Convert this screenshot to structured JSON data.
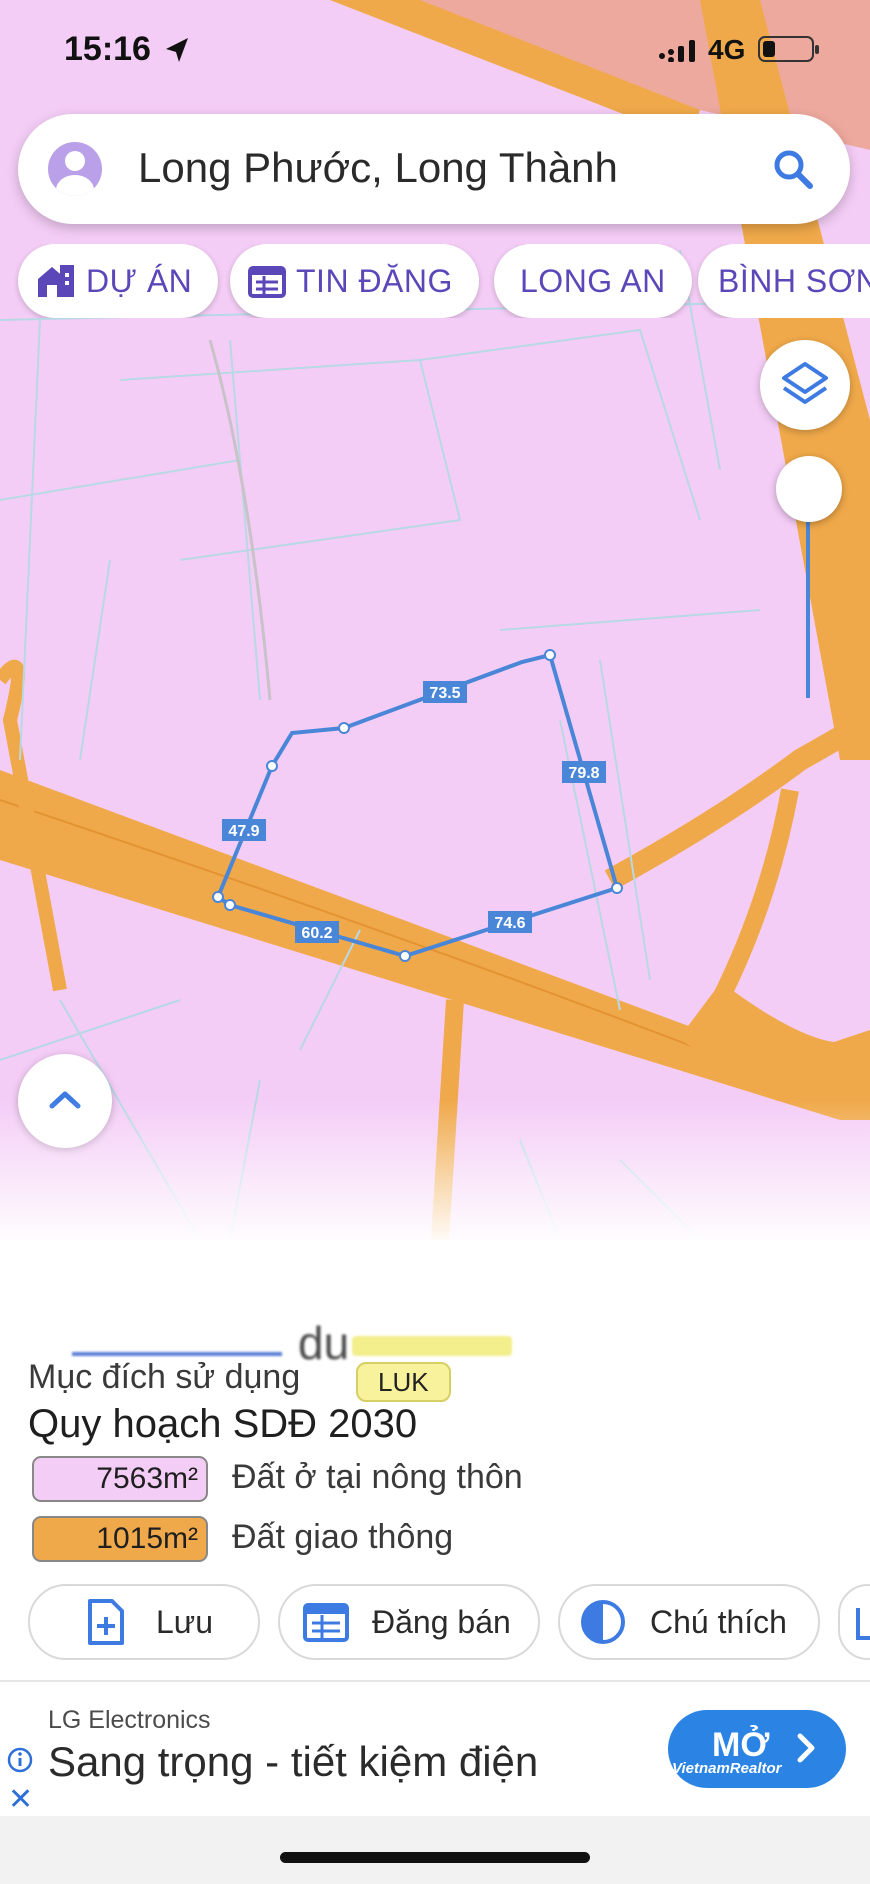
{
  "status_bar": {
    "time": "15:16",
    "network": "4G"
  },
  "search": {
    "query": "Long Phước, Long Thành"
  },
  "chips": [
    {
      "label": "DỰ ÁN",
      "icon": "house-building-icon"
    },
    {
      "label": "TIN ĐĂNG",
      "icon": "calendar-list-icon"
    },
    {
      "label": "LONG AN",
      "icon": ""
    },
    {
      "label": "BÌNH SƠN",
      "icon": ""
    }
  ],
  "map": {
    "edge_labels": [
      "73.5",
      "79.8",
      "74.6",
      "60.2",
      "47.9"
    ],
    "colors": {
      "residential": "#f4cdf6",
      "road": "#f0a94a",
      "parcel_line": "#4a86d8",
      "lot_line": "#b7d8e4"
    }
  },
  "panel": {
    "blurred_text": "du",
    "purpose_label": "Mục đích sử dụng",
    "purpose_code": "LUK",
    "plan_title": "Quy hoạch SDĐ 2030",
    "zones": [
      {
        "area": "7563m²",
        "label": "Đất ở tại nông thôn",
        "color": "#f4cdf6"
      },
      {
        "area": "1015m²",
        "label": "Đất giao thông",
        "color": "#f0a94a"
      }
    ],
    "actions": [
      {
        "label": "Lưu",
        "icon": "save-add-icon"
      },
      {
        "label": "Đăng bán",
        "icon": "calendar-list-icon"
      },
      {
        "label": "Chú thích",
        "icon": "half-circle-icon"
      }
    ]
  },
  "ad": {
    "advertiser": "LG Electronics",
    "headline": "Sang trọng - tiết kiệm điện",
    "cta": "MỞ",
    "watermark": "VietnamRealtor"
  }
}
